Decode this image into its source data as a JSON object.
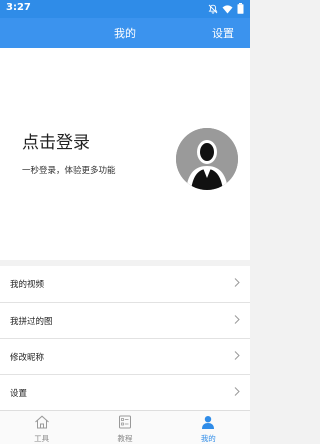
{
  "status_bar": {
    "time": "3:27",
    "icons": [
      "notifications-off-icon",
      "wifi-icon",
      "battery-icon"
    ]
  },
  "header": {
    "title": "我的",
    "settings_label": "设置"
  },
  "profile": {
    "login_title": "点击登录",
    "login_subtitle": "一秒登录，体验更多功能",
    "avatar_icon": "default-avatar-icon"
  },
  "menu": {
    "items": [
      {
        "label": "我的视频"
      },
      {
        "label": "我拼过的图"
      },
      {
        "label": "修改昵称"
      },
      {
        "label": "设置"
      }
    ]
  },
  "tabs": [
    {
      "label": "工具",
      "icon": "home-icon",
      "active": false
    },
    {
      "label": "教程",
      "icon": "tutorial-icon",
      "active": false
    },
    {
      "label": "我的",
      "icon": "user-icon",
      "active": true
    }
  ],
  "colors": {
    "accent": "#2f8ce8",
    "header_bg": "#3b93ee",
    "avatar_bg": "#9a9a9a"
  }
}
